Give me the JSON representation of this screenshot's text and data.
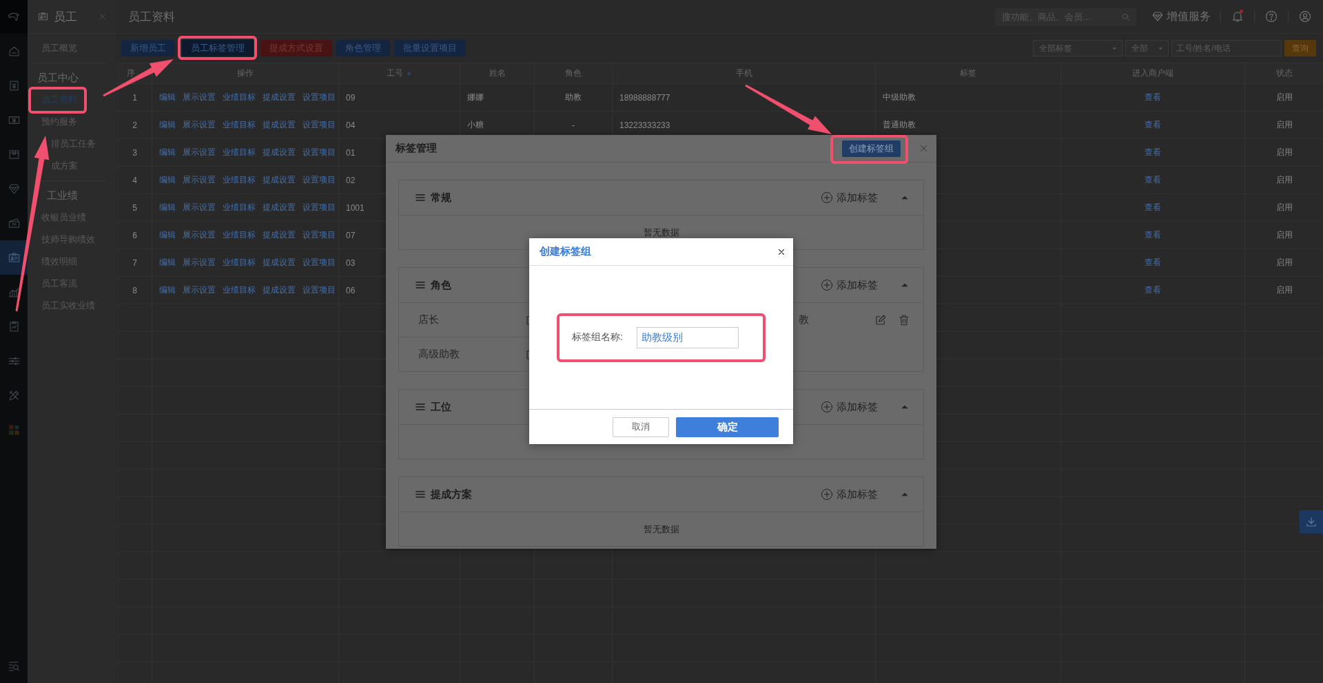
{
  "rail": {
    "items": [
      {
        "selected": false
      },
      {
        "selected": false
      },
      {
        "selected": false
      },
      {
        "selected": false
      },
      {
        "selected": false
      },
      {
        "selected": false
      },
      {
        "selected": true
      },
      {
        "selected": false
      },
      {
        "selected": false
      },
      {
        "selected": false
      },
      {
        "selected": false
      },
      {
        "selected": false
      },
      {
        "selected": false
      }
    ]
  },
  "module": {
    "title": "员工"
  },
  "subnav": [
    {
      "items": [
        {
          "label": "员工概览",
          "selected": false
        }
      ]
    },
    {
      "heading": "员工中心",
      "items": [
        {
          "label": "员工资料",
          "selected": true,
          "highlighted": true
        },
        {
          "label": "预约服务",
          "selected": false
        },
        {
          "label": "排员工任务",
          "selected": false,
          "clipped": true
        },
        {
          "label": "成方案",
          "selected": false,
          "clipped": true
        }
      ]
    },
    {
      "heading": "工业绩",
      "heading_clipped": true,
      "items": [
        {
          "label": "收银员业绩",
          "selected": false
        },
        {
          "label": "技师导购绩效",
          "selected": false
        },
        {
          "label": "绩效明细",
          "selected": false
        },
        {
          "label": "员工客流",
          "selected": false
        },
        {
          "label": "员工实收业绩",
          "selected": false
        }
      ]
    }
  ],
  "header": {
    "title": "员工资料",
    "search_placeholder": "搜功能、商品、会员…",
    "value_added": "增值服务",
    "unread": true
  },
  "toolbar": {
    "buttons": [
      {
        "label": "新增员工",
        "kind": "primary"
      },
      {
        "label": "员工标签管理",
        "kind": "pressed",
        "highlighted": true
      },
      {
        "label": "提成方式设置",
        "kind": "danger"
      },
      {
        "label": "角色管理",
        "kind": "primary"
      },
      {
        "label": "批量设置项目",
        "kind": "primary"
      }
    ],
    "filters": {
      "tag_select": "全部标签",
      "status_select": "全部",
      "search_placeholder": "工号/姓名/电话",
      "query_button": "查询"
    }
  },
  "table": {
    "columns": [
      {
        "label": "序",
        "sortable": false
      },
      {
        "label": "操作",
        "sortable": false
      },
      {
        "label": "工号",
        "sortable": true
      },
      {
        "label": "姓名",
        "sortable": false
      },
      {
        "label": "角色",
        "sortable": false
      },
      {
        "label": "手机",
        "sortable": false
      },
      {
        "label": "标签",
        "sortable": false
      },
      {
        "label": "进入商户端",
        "sortable": false
      },
      {
        "label": "状态",
        "sortable": false
      }
    ],
    "rows": [
      {
        "index": "1",
        "actions": [
          "编辑",
          "展示设置",
          "业绩目标",
          "提成设置",
          "设置项目"
        ],
        "employee_no": "09",
        "name": "娜娜",
        "role": "助教",
        "phone": "18988888777",
        "tag": "中级助教",
        "merchant_link": "查看",
        "status": "启用"
      },
      {
        "index": "2",
        "actions": [
          "编辑",
          "展示设置",
          "业绩目标",
          "提成设置",
          "设置项目"
        ],
        "employee_no": "04",
        "name": "小糖",
        "role": "-",
        "phone": "13223333233",
        "tag": "普通助教",
        "merchant_link": "查看",
        "status": "启用"
      },
      {
        "index": "3",
        "actions": [
          "编辑",
          "展示设置",
          "业绩目标",
          "提成设置",
          "设置项目"
        ],
        "employee_no": "01",
        "merchant_link": "查看",
        "status": "启用"
      },
      {
        "index": "4",
        "actions": [
          "编辑",
          "展示设置",
          "业绩目标",
          "提成设置",
          "设置项目"
        ],
        "employee_no": "02",
        "merchant_link": "查看",
        "status": "启用"
      },
      {
        "index": "5",
        "actions": [
          "编辑",
          "展示设置",
          "业绩目标",
          "提成设置",
          "设置项目"
        ],
        "employee_no": "1001",
        "merchant_link": "查看",
        "status": "启用"
      },
      {
        "index": "6",
        "actions": [
          "编辑",
          "展示设置",
          "业绩目标",
          "提成设置",
          "设置项目"
        ],
        "employee_no": "07",
        "merchant_link": "查看",
        "status": "启用"
      },
      {
        "index": "7",
        "actions": [
          "编辑",
          "展示设置",
          "业绩目标",
          "提成设置",
          "设置项目"
        ],
        "employee_no": "03",
        "merchant_link": "查看",
        "status": "启用"
      },
      {
        "index": "8",
        "actions": [
          "编辑",
          "展示设置",
          "业绩目标",
          "提成设置",
          "设置项目"
        ],
        "employee_no": "06",
        "merchant_link": "查看",
        "status": "启用"
      }
    ]
  },
  "float_actions": [
    {
      "kind": "download"
    }
  ],
  "tag_manager": {
    "title": "标签管理",
    "create_button": "创建标签组",
    "create_highlighted": true,
    "groups": [
      {
        "title": "常规",
        "add_label": "添加标签",
        "expanded": true,
        "empty_text": "暂无数据"
      },
      {
        "title": "角色",
        "add_label": "添加标签",
        "expanded": true,
        "tags": [
          {
            "kind": "tag",
            "label": "店长",
            "edit": true,
            "delete": false
          },
          {
            "kind": "blank"
          },
          {
            "kind": "tag",
            "label": "教",
            "clipped": true,
            "edit": true,
            "delete": true
          },
          {
            "kind": "tag",
            "label": "高级助教",
            "edit": true,
            "delete": false
          }
        ]
      },
      {
        "title": "工位",
        "add_label": "添加标签",
        "expanded": true
      },
      {
        "title": "提成方案",
        "add_label": "添加标签",
        "expanded": true,
        "empty_text": "暂无数据"
      }
    ]
  },
  "create_dialog": {
    "title": "创建标签组",
    "field_label": "标签组名称:",
    "field_value": "助教级别",
    "highlighted": true,
    "cancel": "取消",
    "confirm": "确定"
  },
  "annotation_arrows": [
    {
      "kind": "arrow"
    },
    {
      "kind": "arrow"
    },
    {
      "kind": "arrow"
    }
  ]
}
